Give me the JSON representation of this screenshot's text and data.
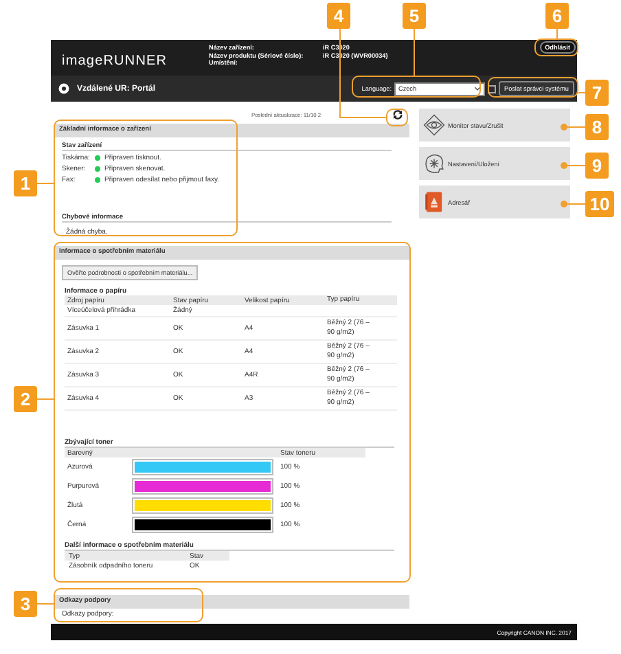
{
  "header": {
    "logo": "imageRUNNER",
    "info": [
      {
        "label": "Název zařízení:",
        "value": "iR C3020"
      },
      {
        "label": "Název produktu (Sériové číslo):",
        "value": "iR C3020 (WVR00034)"
      },
      {
        "label": "Umístění:"
      }
    ],
    "logout": "Odhlásit",
    "portal_title": "Vzdálené UR: Portál",
    "language_label": "Language:",
    "language_value": "Czech",
    "send_button": "Poslat správci systému"
  },
  "last_update": "Poslední aktualizace: 11/10 2",
  "basic_info": {
    "title": "Základní informace o zařízení",
    "status_title": "Stav zařízení",
    "statuses": [
      {
        "label": "Tiskárna:",
        "text": "Připraven tisknout.",
        "color": "#22cc55"
      },
      {
        "label": "Skener:",
        "text": "Připraven skenovat.",
        "color": "#22cc55"
      },
      {
        "label": "Fax:",
        "text": "Připraven odesílat nebo přijmout faxy.",
        "color": "#22cc55"
      }
    ],
    "error_title": "Chybové informace",
    "error_text": "Žádná chyba."
  },
  "consumables": {
    "title": "Informace o spotřebním materiálu",
    "details_button": "Ověřte podrobnosti o spotřebním materiálu...",
    "paper": {
      "title": "Informace o papíru",
      "columns": [
        "Zdroj papíru",
        "Stav papíru",
        "Velikost papíru",
        "Typ papíru"
      ],
      "rows": [
        [
          "Víceúčelová přihrádka",
          "Žádný"
        ],
        [
          "Zásuvka 1",
          "OK",
          "A4",
          "Běžný 2 (76 –90 g/m2)"
        ],
        [
          "Zásuvka 2",
          "OK",
          "A4",
          "Běžný 2 (76 –90 g/m2)"
        ],
        [
          "Zásuvka 3",
          "OK",
          "A4R",
          "Běžný 2 (76 –90 g/m2)"
        ],
        [
          "Zásuvka 4",
          "OK",
          "A3",
          "Běžný 2 (76 –90 g/m2)"
        ]
      ]
    },
    "toner": {
      "title": "Zbývající toner",
      "columns": [
        "Barevný",
        "Stav toneru"
      ],
      "rows": [
        {
          "name": "Azurová",
          "color": "#33c8f5",
          "level": 1,
          "reading": "100 %"
        },
        {
          "name": "Purpurová",
          "color": "#e62bd4",
          "level": 1,
          "reading": "100 %"
        },
        {
          "name": "Žlutá",
          "color": "#ffdd00",
          "level": 1,
          "reading": "100 %"
        },
        {
          "name": "Černá",
          "color": "#000000",
          "level": 1,
          "reading": "100 %"
        }
      ]
    },
    "other": {
      "title": "Další informace o spotřebním materiálu",
      "columns": [
        "Typ",
        "Stav"
      ],
      "rows": [
        [
          "Zásobník odpadního toneru",
          "OK"
        ]
      ]
    }
  },
  "support": {
    "title": "Odkazy podpory",
    "text": "Odkazy podpory:"
  },
  "menu": [
    {
      "label": "Monitor stavu/Zrušit",
      "kind": "eye"
    },
    {
      "label": "Nastavení/Uložení",
      "kind": "settings"
    },
    {
      "label": "Adresář",
      "kind": "book"
    }
  ],
  "footer": "Copyright CANON INC. 2017",
  "callouts": [
    "1",
    "2",
    "3",
    "4",
    "5",
    "6",
    "7",
    "8",
    "9",
    "10"
  ]
}
